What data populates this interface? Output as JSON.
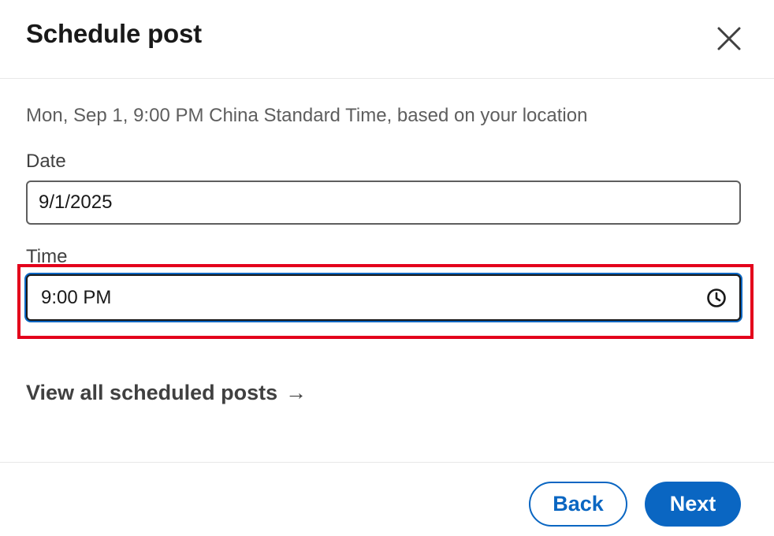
{
  "dialog": {
    "title": "Schedule post",
    "close_icon": "close-icon",
    "subtitle": "Mon, Sep 1, 9:00 PM China Standard Time, based on your location"
  },
  "date_field": {
    "label": "Date",
    "value": "9/1/2025"
  },
  "time_field": {
    "label": "Time",
    "value": "9:00 PM",
    "icon": "clock-icon"
  },
  "view_all": {
    "label": "View all scheduled posts",
    "arrow": "→"
  },
  "footer": {
    "back_label": "Back",
    "next_label": "Next"
  },
  "colors": {
    "accent": "#0a66c2",
    "highlight": "#e3001b"
  }
}
